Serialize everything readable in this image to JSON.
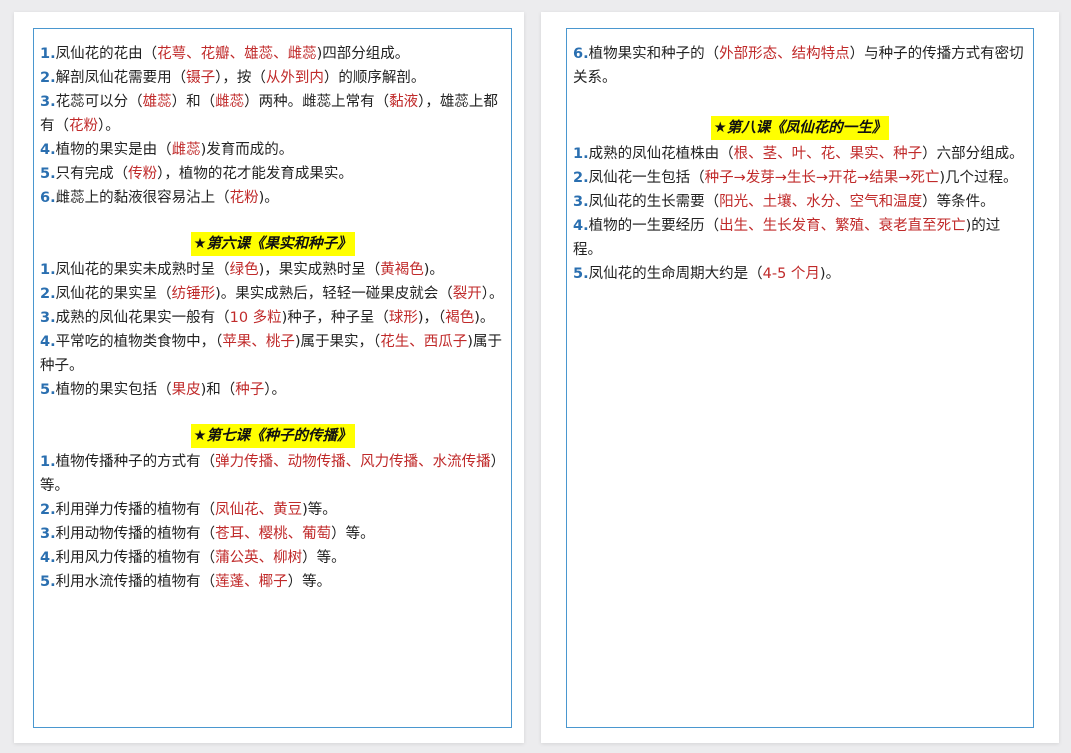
{
  "left_page": {
    "items_a": [
      {
        "n": "1.",
        "segments": [
          {
            "t": "凤仙花的花由（"
          },
          {
            "t": "花萼、花瓣、雄蕊、雌蕊",
            "h": true
          },
          {
            "t": ")四部分组成。"
          }
        ]
      },
      {
        "n": "2.",
        "segments": [
          {
            "t": "解剖凤仙花需要用（"
          },
          {
            "t": "镊子",
            "h": true
          },
          {
            "t": "），按（"
          },
          {
            "t": "从外到内",
            "h": true
          },
          {
            "t": "）的顺序解剖。"
          }
        ]
      },
      {
        "n": "3.",
        "segments": [
          {
            "t": "花蕊可以分（"
          },
          {
            "t": "雄蕊",
            "h": true
          },
          {
            "t": "）和（"
          },
          {
            "t": "雌蕊",
            "h": true
          },
          {
            "t": "）两种。雌蕊上常有（"
          },
          {
            "t": "黏液",
            "h": true
          },
          {
            "t": "），雄蕊上都有（"
          },
          {
            "t": "花粉",
            "h": true
          },
          {
            "t": "）。"
          }
        ]
      },
      {
        "n": "4.",
        "segments": [
          {
            "t": "植物的果实是由（"
          },
          {
            "t": "雌蕊",
            "h": true
          },
          {
            "t": ")发育而成的。"
          }
        ]
      },
      {
        "n": "5.",
        "segments": [
          {
            "t": "只有完成（"
          },
          {
            "t": "传粉",
            "h": true
          },
          {
            "t": "），植物的花才能发育成果实。"
          }
        ]
      },
      {
        "n": "6.",
        "segments": [
          {
            "t": "雌蕊上的黏液很容易沾上（"
          },
          {
            "t": "花粉",
            "h": true
          },
          {
            "t": ")。"
          }
        ]
      }
    ],
    "heading_b": "★第六课《果实和种子》",
    "items_b": [
      {
        "n": "1.",
        "segments": [
          {
            "t": "凤仙花的果实未成熟时呈（"
          },
          {
            "t": "绿色",
            "h": true
          },
          {
            "t": ")，果实成熟时呈（"
          },
          {
            "t": "黄褐色",
            "h": true
          },
          {
            "t": ")。"
          }
        ]
      },
      {
        "n": "2.",
        "segments": [
          {
            "t": "凤仙花的果实呈（"
          },
          {
            "t": "纺锤形",
            "h": true
          },
          {
            "t": ")。果实成熟后，轻轻一碰果皮就会（"
          },
          {
            "t": "裂开",
            "h": true
          },
          {
            "t": "）。"
          }
        ]
      },
      {
        "n": "3.",
        "segments": [
          {
            "t": "成熟的凤仙花果实一般有（"
          },
          {
            "t": "10 多粒",
            "h": true
          },
          {
            "t": ")种子，种子呈（"
          },
          {
            "t": "球形",
            "h": true
          },
          {
            "t": ")，（"
          },
          {
            "t": "褐色",
            "h": true
          },
          {
            "t": ")。"
          }
        ]
      },
      {
        "n": "4.",
        "segments": [
          {
            "t": "平常吃的植物类食物中，（"
          },
          {
            "t": "苹果、桃子",
            "h": true
          },
          {
            "t": ")属于果实，（"
          },
          {
            "t": "花生、西瓜子",
            "h": true
          },
          {
            "t": ")属于种子。"
          }
        ]
      },
      {
        "n": "5.",
        "segments": [
          {
            "t": "植物的果实包括（"
          },
          {
            "t": "果皮",
            "h": true
          },
          {
            "t": ")和（"
          },
          {
            "t": "种子",
            "h": true
          },
          {
            "t": "）。"
          }
        ]
      }
    ],
    "heading_c": "★第七课《种子的传播》",
    "items_c": [
      {
        "n": "1.",
        "segments": [
          {
            "t": "植物传播种子的方式有（"
          },
          {
            "t": "弹力传播、动物传播、风力传播、水流传播",
            "h": true
          },
          {
            "t": "）等。"
          }
        ]
      },
      {
        "n": "2.",
        "segments": [
          {
            "t": "利用弹力传播的植物有（"
          },
          {
            "t": "凤仙花、黄豆",
            "h": true
          },
          {
            "t": ")等。"
          }
        ]
      },
      {
        "n": "3.",
        "segments": [
          {
            "t": "利用动物传播的植物有（"
          },
          {
            "t": "苍耳、樱桃、葡萄",
            "h": true
          },
          {
            "t": "）等。"
          }
        ]
      },
      {
        "n": "4.",
        "segments": [
          {
            "t": "利用风力传播的植物有（"
          },
          {
            "t": "蒲公英、柳树",
            "h": true
          },
          {
            "t": "）等。"
          }
        ]
      },
      {
        "n": "5.",
        "segments": [
          {
            "t": "利用水流传播的植物有（"
          },
          {
            "t": "莲蓬、椰子",
            "h": true
          },
          {
            "t": "）等。"
          }
        ]
      }
    ]
  },
  "right_page": {
    "items_a": [
      {
        "n": "6.",
        "segments": [
          {
            "t": "植物果实和种子的（"
          },
          {
            "t": "外部形态、结构特点",
            "h": true
          },
          {
            "t": "）与种子的传播方式有密切关系。"
          }
        ]
      }
    ],
    "heading_b": "★第八课《凤仙花的一生》",
    "items_b": [
      {
        "n": "1.",
        "segments": [
          {
            "t": "成熟的凤仙花植株由（"
          },
          {
            "t": "根、茎、叶、花、果实、种子",
            "h": true
          },
          {
            "t": "）六部分组成。"
          }
        ]
      },
      {
        "n": "2.",
        "segments": [
          {
            "t": "凤仙花一生包括（"
          },
          {
            "t": "种子→发芽→生长→开花→结果→死亡",
            "h": true
          },
          {
            "t": ")几个过程。"
          }
        ]
      },
      {
        "n": "3.",
        "segments": [
          {
            "t": "凤仙花的生长需要（"
          },
          {
            "t": "阳光、土壤、水分、空气和温度",
            "h": true
          },
          {
            "t": "）等条件。"
          }
        ]
      },
      {
        "n": "4.",
        "segments": [
          {
            "t": "植物的一生要经历（"
          },
          {
            "t": "出生、生长发育、繁殖、衰老直至死亡",
            "h": true
          },
          {
            "t": ")的过程。"
          }
        ]
      },
      {
        "n": "5.",
        "segments": [
          {
            "t": "凤仙花的生命周期大约是（"
          },
          {
            "t": "4-5 个月",
            "h": true
          },
          {
            "t": ")。"
          }
        ]
      }
    ]
  },
  "colors": {
    "number": "#2a6fb0",
    "answer": "#c02a2a",
    "heading_bg": "#ffff00",
    "frame": "#4a97cf"
  }
}
